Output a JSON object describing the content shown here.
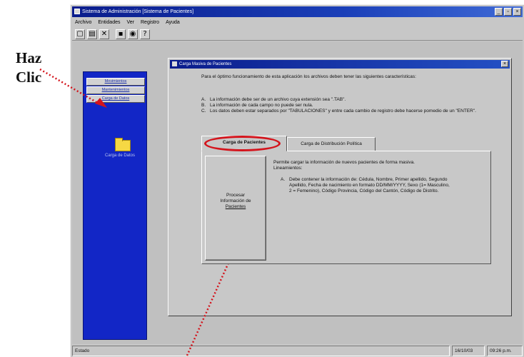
{
  "annotation": {
    "line1": "Haz",
    "line2": "Clic"
  },
  "window": {
    "title": "Sistema de Administración [Sistema de Pacientes]"
  },
  "menu": [
    "Archivo",
    "Entidades",
    "Ver",
    "Registro",
    "Ayuda"
  ],
  "toolbar": {
    "icons": [
      "new-icon",
      "open-icon",
      "delete-icon",
      "save-icon",
      "find-icon",
      "help-icon"
    ]
  },
  "nav": {
    "items": [
      "Movimientos",
      "Mantenimientos",
      "Carga de Datos"
    ],
    "folder_label": "Carga de Datos"
  },
  "dialog": {
    "title": "Carga Masiva de Pacientes",
    "close": "×",
    "intro": "Para el óptimo funcionamiento de esta aplicación los archivos deben tener las siguientes características:",
    "requirements": [
      {
        "letter": "A.",
        "text": "La información debe ser de un archivo cuya extensión sea \".TAB\"."
      },
      {
        "letter": "B.",
        "text": "La información de cada campo no puede ser nula."
      },
      {
        "letter": "C.",
        "text": "Los datos deben estar separados por \"TABULACIONES\" y entre cada cambio de registro debe hacerse pomedio de un \"ENTER\"."
      }
    ],
    "tabs": [
      "Carga de Pacientes",
      "Carga de Distribución Política"
    ],
    "action_button": {
      "line1": "Procesar",
      "line2": "Información de",
      "line3": "Pacientes"
    },
    "description": {
      "text": "Permite cargar la información de nuevos pacientes de forma masiva.",
      "guidelines_label": "Lineamientos:",
      "item_letter": "A.",
      "item_text": "Debe contener la información de: Cédula, Nombre, Primer apellido, Segundo Apellido, Fecha de nacimiento en formato DD/MM/YYYY, Sexo (1= Masculino, 2 = Femenino), Código Provincia, Código del Cantón, Código de Distrito."
    }
  },
  "status": {
    "label": "Estado",
    "date": "16/10/03",
    "time": "09:26 p.m."
  },
  "colors": {
    "title_bar": "#0a1c8c",
    "nav_panel": "#1226c6",
    "highlight": "#d4141c",
    "background": "#c0c0c0"
  }
}
